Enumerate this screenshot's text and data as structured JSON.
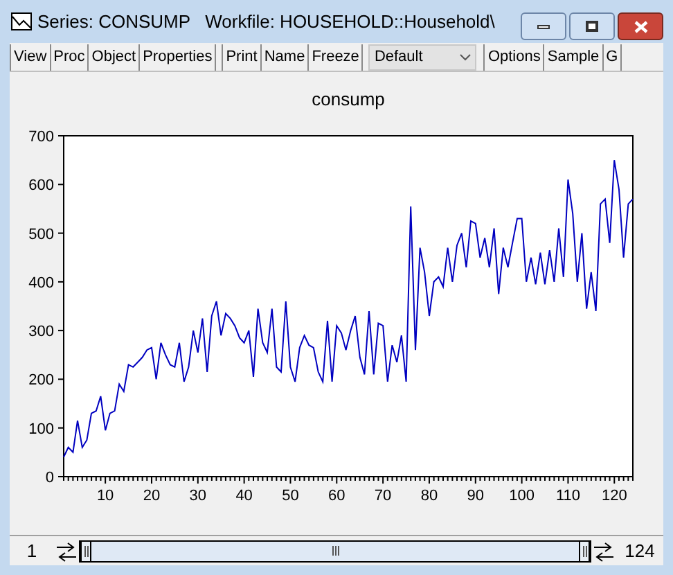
{
  "window": {
    "title": "Series: CONSUMP   Workfile: HOUSEHOLD::Household\\"
  },
  "toolbar": {
    "groups": [
      [
        "View",
        "Proc",
        "Object",
        "Properties"
      ],
      [
        "Print",
        "Name",
        "Freeze"
      ]
    ],
    "dropdown": {
      "value": "Default"
    },
    "right_buttons": [
      "Options",
      "Sample",
      "G"
    ]
  },
  "graph": {
    "chart_data": {
      "type": "line",
      "title": "consump",
      "x": [
        1,
        2,
        3,
        4,
        5,
        6,
        7,
        8,
        9,
        10,
        11,
        12,
        13,
        14,
        15,
        16,
        17,
        18,
        19,
        20,
        21,
        22,
        23,
        24,
        25,
        26,
        27,
        28,
        29,
        30,
        31,
        32,
        33,
        34,
        35,
        36,
        37,
        38,
        39,
        40,
        41,
        42,
        43,
        44,
        45,
        46,
        47,
        48,
        49,
        50,
        51,
        52,
        53,
        54,
        55,
        56,
        57,
        58,
        59,
        60,
        61,
        62,
        63,
        64,
        65,
        66,
        67,
        68,
        69,
        70,
        71,
        72,
        73,
        74,
        75,
        76,
        77,
        78,
        79,
        80,
        81,
        82,
        83,
        84,
        85,
        86,
        87,
        88,
        89,
        90,
        91,
        92,
        93,
        94,
        95,
        96,
        97,
        98,
        99,
        100,
        101,
        102,
        103,
        104,
        105,
        106,
        107,
        108,
        109,
        110,
        111,
        112,
        113,
        114,
        115,
        116,
        117,
        118,
        119,
        120,
        121,
        122,
        123,
        124
      ],
      "series": [
        {
          "color": "#0000c0",
          "values": [
            40,
            60,
            50,
            115,
            60,
            75,
            130,
            135,
            165,
            95,
            130,
            135,
            190,
            175,
            230,
            225,
            235,
            245,
            260,
            265,
            200,
            275,
            250,
            230,
            225,
            275,
            195,
            225,
            300,
            255,
            325,
            215,
            330,
            360,
            290,
            335,
            325,
            310,
            285,
            275,
            300,
            205,
            345,
            275,
            255,
            345,
            225,
            215,
            360,
            225,
            195,
            265,
            290,
            270,
            265,
            215,
            195,
            320,
            195,
            310,
            295,
            260,
            300,
            330,
            245,
            210,
            340,
            210,
            315,
            310,
            195,
            270,
            235,
            290,
            195,
            555,
            260,
            470,
            420,
            330,
            400,
            410,
            390,
            470,
            400,
            475,
            500,
            430,
            525,
            520,
            450,
            490,
            430,
            510,
            375,
            470,
            430,
            480,
            530,
            530,
            400,
            450,
            395,
            460,
            395,
            465,
            400,
            510,
            410,
            610,
            540,
            400,
            500,
            345,
            420,
            340,
            560,
            570,
            480,
            650,
            590,
            450,
            560,
            570
          ]
        }
      ],
      "xlim": [
        1,
        124
      ],
      "ylim": [
        0,
        700
      ],
      "xticks": [
        10,
        20,
        30,
        40,
        50,
        60,
        70,
        80,
        90,
        100,
        110,
        120
      ],
      "yticks": [
        0,
        100,
        200,
        300,
        400,
        500,
        600,
        700
      ]
    }
  },
  "sample_bar": {
    "start": "1",
    "end": "124"
  }
}
